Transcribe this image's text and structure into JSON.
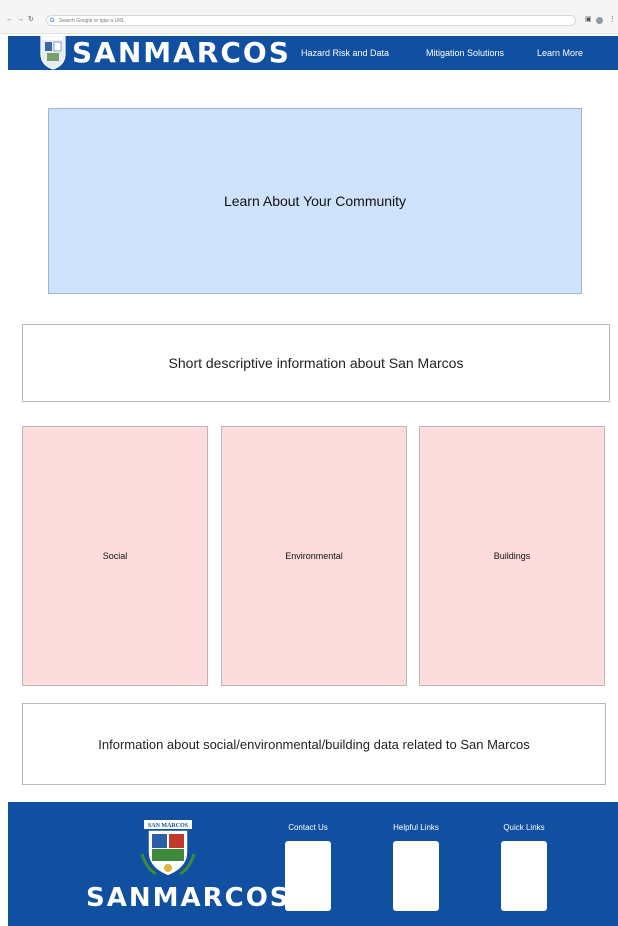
{
  "browser": {
    "omnibox_placeholder": "Search Google or type a URL",
    "nav_icons": [
      "back-icon",
      "forward-icon",
      "reload-icon"
    ]
  },
  "header": {
    "brand": "SANMARCOS",
    "nav": [
      {
        "label": "Hazard Risk and Data"
      },
      {
        "label": "Mitigation Solutions"
      },
      {
        "label": "Learn More"
      }
    ],
    "background_color": "#1150a0"
  },
  "hero": {
    "label": "Learn About Your Community",
    "background_color": "#cfe2fb"
  },
  "description": {
    "label": "Short descriptive information about San Marcos"
  },
  "cards": [
    {
      "label": "Social"
    },
    {
      "label": "Environmental"
    },
    {
      "label": "Buildings"
    }
  ],
  "card_color": "#fcdcdc",
  "info": {
    "label": "Information about social/environmental/building data related to San Marcos"
  },
  "footer": {
    "brand": "SANMARCOS",
    "seal_text": "SAN MARCOS",
    "headings": [
      "Contact Us",
      "Helpful Links",
      "Quick Links"
    ]
  }
}
